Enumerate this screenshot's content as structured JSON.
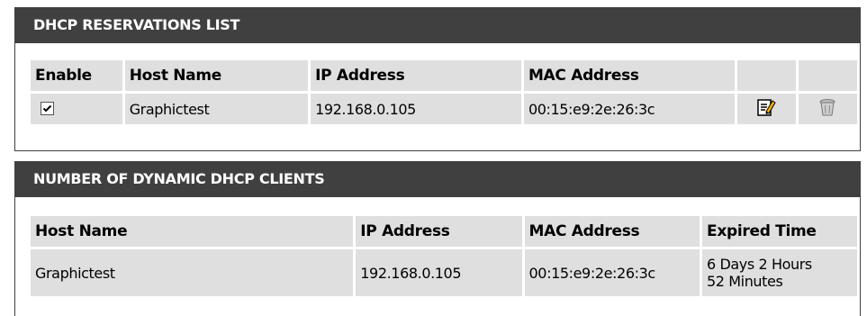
{
  "reservations": {
    "title": "DHCP RESERVATIONS LIST",
    "headers": [
      "Enable",
      "Host Name",
      "IP Address",
      "MAC Address",
      "",
      ""
    ],
    "rows": [
      {
        "enabled": true,
        "host_name": "Graphictest",
        "ip_address": "192.168.0.105",
        "mac_address": "00:15:e9:2e:26:3c",
        "edit_icon": "edit-icon",
        "delete_icon": "trash-icon"
      }
    ]
  },
  "dynamic_clients": {
    "title": "NUMBER OF DYNAMIC DHCP CLIENTS",
    "headers": [
      "Host Name",
      "IP Address",
      "MAC Address",
      "Expired Time"
    ],
    "rows": [
      {
        "host_name": "Graphictest",
        "ip_address": "192.168.0.105",
        "mac_address": "00:15:e9:2e:26:3c",
        "expired_time_line1": "6 Days 2 Hours",
        "expired_time_line2": "52 Minutes"
      }
    ]
  },
  "colors": {
    "header_bg": "#404040",
    "cell_bg": "#dfdfdf",
    "header_text": "#ffffff"
  }
}
